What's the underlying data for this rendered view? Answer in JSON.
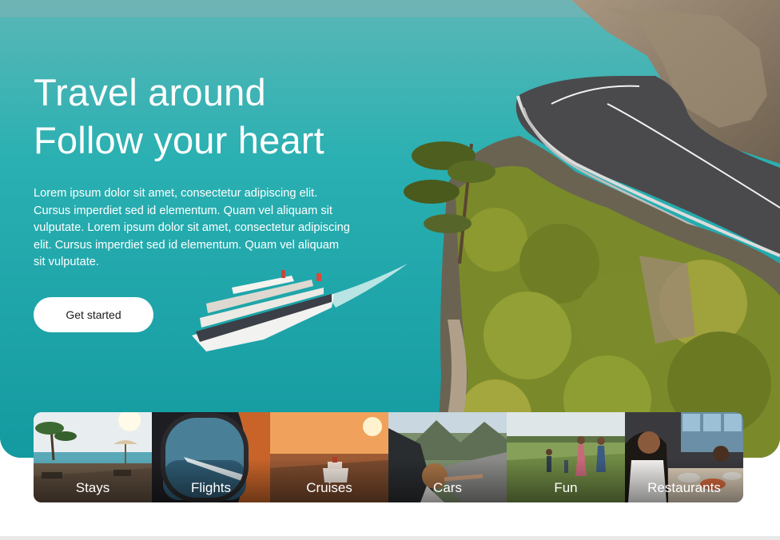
{
  "hero": {
    "title_line1": "Travel around",
    "title_line2": "Follow your heart",
    "description": "Lorem ipsum dolor sit amet, consectetur adipiscing elit. Cursus imperdiet sed id elementum. Quam vel aliquam sit vulputate. Lorem ipsum dolor sit amet, consectetur adipiscing elit. Cursus imperdiet sed id elementum. Quam vel aliquam sit vulputate.",
    "cta_label": "Get started"
  },
  "categories": [
    {
      "label": "Stays",
      "icon": "beach-photo"
    },
    {
      "label": "Flights",
      "icon": "airplane-window-photo"
    },
    {
      "label": "Cruises",
      "icon": "cruise-ship-photo"
    },
    {
      "label": "Cars",
      "icon": "car-trip-photo"
    },
    {
      "label": "Fun",
      "icon": "family-field-photo"
    },
    {
      "label": "Restaurants",
      "icon": "dining-photo"
    }
  ],
  "colors": {
    "sea": "#23a8ac",
    "cliff": "#8a7a66",
    "foliage": "#7b8a2a",
    "button_bg": "#ffffff",
    "text_light": "#ffffff"
  }
}
